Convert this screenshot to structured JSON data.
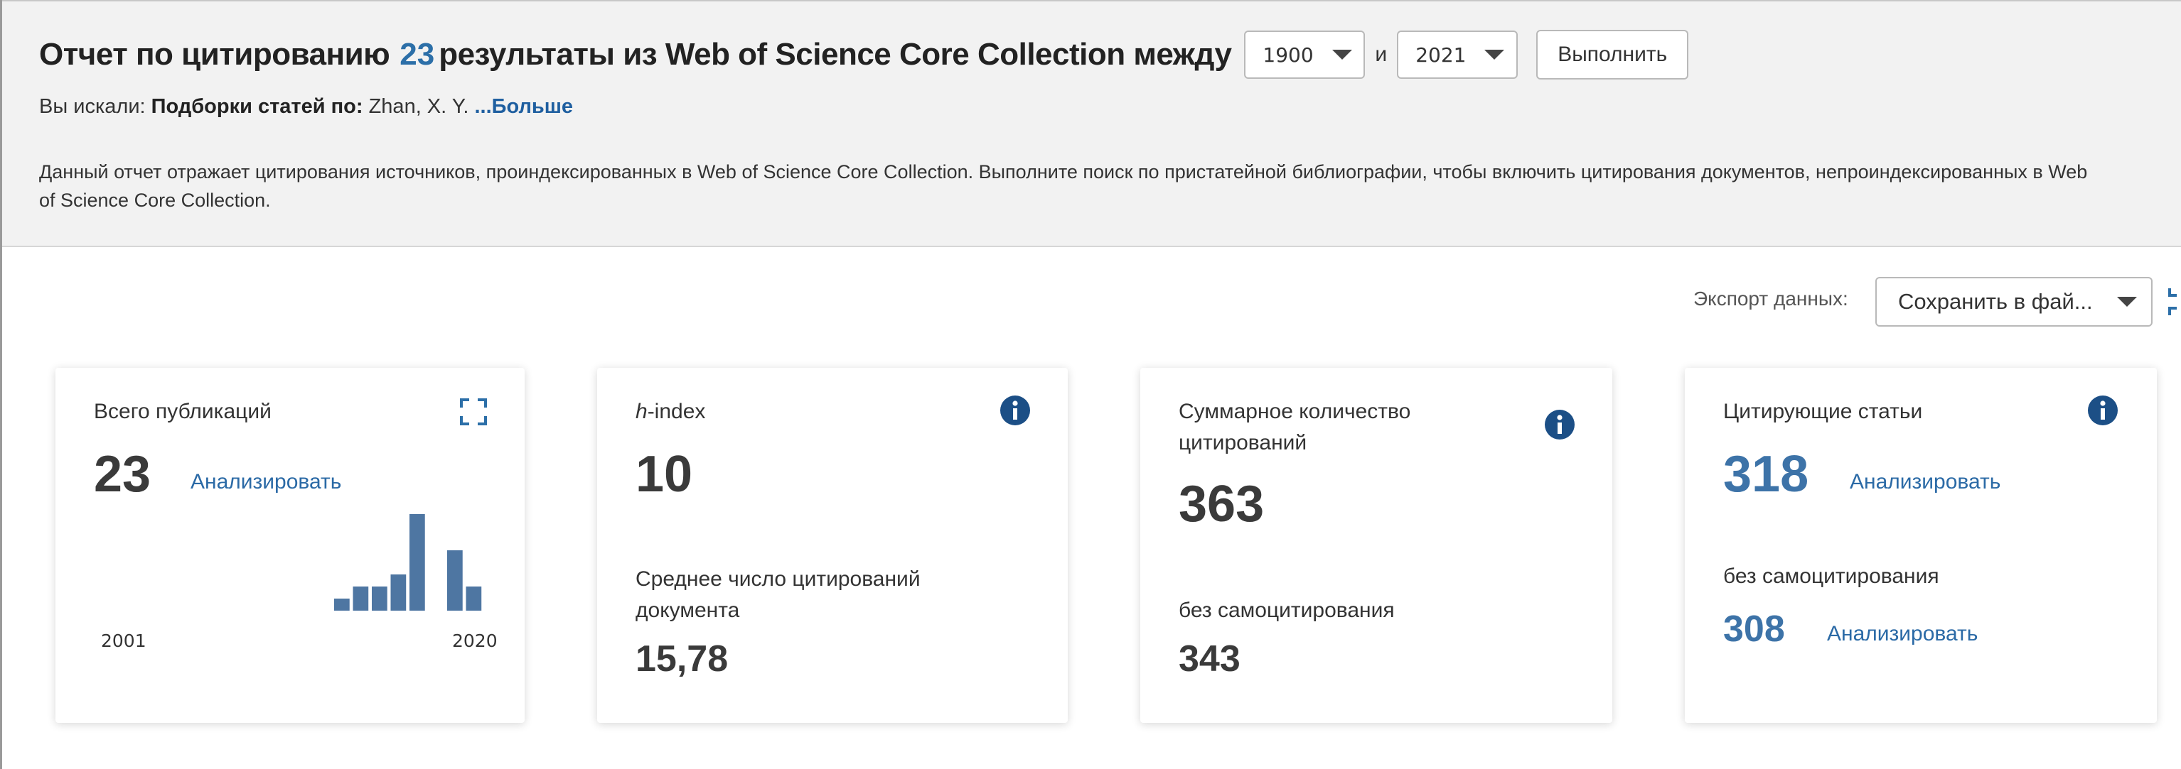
{
  "header": {
    "title_prefix": "Отчет по цитированию",
    "result_count": "23",
    "title_suffix": "результаты из Web of Science Core Collection между",
    "year_from": "1900",
    "and_label": "и",
    "year_to": "2021",
    "run_button": "Выполнить",
    "searched_label": "Вы искали:",
    "searched_field": "Подборки статей по:",
    "searched_value": "Zhan, X. Y.",
    "more_link": "...Больше",
    "description": "Данный отчет отражает цитирования источников, проиндексированных в Web of Science Core Collection. Выполните поиск по пристатейной библиографии, чтобы включить цитирования документов, непроиндексированных в Web of Science Core Collection."
  },
  "export": {
    "label": "Экспорт данных:",
    "selected": "Сохранить в фай..."
  },
  "cards": {
    "publications": {
      "label": "Всего публикаций",
      "value": "23",
      "analyze_link": "Анализировать",
      "year_start": "2001",
      "year_end": "2020",
      "histogram": [
        1,
        2,
        2,
        3,
        8,
        0,
        5,
        2
      ]
    },
    "hindex": {
      "label_italic": "h",
      "label_rest": "-index",
      "value": "10",
      "avg_label_line1": "Среднее число цитирований",
      "avg_label_line2": "документа",
      "avg_value": "15,78"
    },
    "total_citations": {
      "label_line1": "Суммарное количество",
      "label_line2": "цитирований",
      "value": "363",
      "self_label": "без самоцитирования",
      "self_value": "343"
    },
    "citing_articles": {
      "label": "Цитирующие статьи",
      "value": "318",
      "analyze_link": "Анализировать",
      "self_label": "без самоцитирования",
      "self_value": "308",
      "self_analyze_link": "Анализировать"
    }
  },
  "colors": {
    "accent_blue": "#3d73a8",
    "link_blue": "#2b6aa6",
    "bar": "#4e76a2",
    "info_icon": "#1c4f86"
  },
  "icons": [
    "expand-icon",
    "info-icon",
    "chevron-down-icon"
  ]
}
